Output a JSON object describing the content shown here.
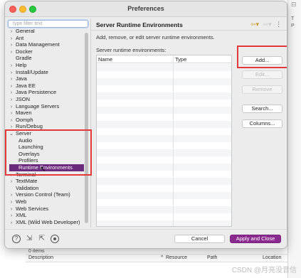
{
  "dialog": {
    "title": "Preferences"
  },
  "left": {
    "filter_placeholder": "type filter text",
    "tree": [
      {
        "label": "General",
        "expandable": true
      },
      {
        "label": "Ant",
        "expandable": true
      },
      {
        "label": "Data Management",
        "expandable": true
      },
      {
        "label": "Docker",
        "expandable": true
      },
      {
        "label": "Gradle",
        "expandable": false
      },
      {
        "label": "Help",
        "expandable": true
      },
      {
        "label": "Install/Update",
        "expandable": true
      },
      {
        "label": "Java",
        "expandable": true
      },
      {
        "label": "Java EE",
        "expandable": true
      },
      {
        "label": "Java Persistence",
        "expandable": true
      },
      {
        "label": "JSON",
        "expandable": true
      },
      {
        "label": "Language Servers",
        "expandable": true
      },
      {
        "label": "Maven",
        "expandable": true
      },
      {
        "label": "Oomph",
        "expandable": true
      },
      {
        "label": "Run/Debug",
        "expandable": true
      },
      {
        "label": "Server",
        "expandable": true,
        "expanded": true
      },
      {
        "label": "Audio",
        "child": true
      },
      {
        "label": "Launching",
        "child": true
      },
      {
        "label": "Overlays",
        "child": true
      },
      {
        "label": "Profilers",
        "child": true
      },
      {
        "label": "Runtime Environments",
        "child": true,
        "selected": true
      },
      {
        "label": "Terminal",
        "expandable": true
      },
      {
        "label": "TextMate",
        "expandable": true
      },
      {
        "label": "Validation",
        "expandable": false
      },
      {
        "label": "Version Control (Team)",
        "expandable": true
      },
      {
        "label": "Web",
        "expandable": true
      },
      {
        "label": "Web Services",
        "expandable": true
      },
      {
        "label": "XML",
        "expandable": true
      },
      {
        "label": "XML (Wild Web Developer)",
        "expandable": true
      }
    ]
  },
  "right": {
    "section_title": "Server Runtime Environments",
    "description": "Add, remove, or edit server runtime environments.",
    "table_label": "Server runtime environments:",
    "columns": [
      "Name",
      "Type"
    ],
    "buttons": {
      "add": "Add...",
      "edit": "Edit...",
      "remove": "Remove",
      "search": "Search...",
      "columns": "Columns..."
    }
  },
  "footer": {
    "cancel": "Cancel",
    "apply_close": "Apply and Close"
  },
  "background": {
    "items_count": "0 items",
    "columns": [
      "Description",
      "Resource",
      "Path",
      "Location"
    ],
    "side_letters": [
      "T",
      "P"
    ]
  },
  "watermark": "CSDN @月亮没音信",
  "colors": {
    "accent": "#8a2a8f",
    "selection": "#6c2a7d",
    "annotation": "#e23a3a"
  }
}
